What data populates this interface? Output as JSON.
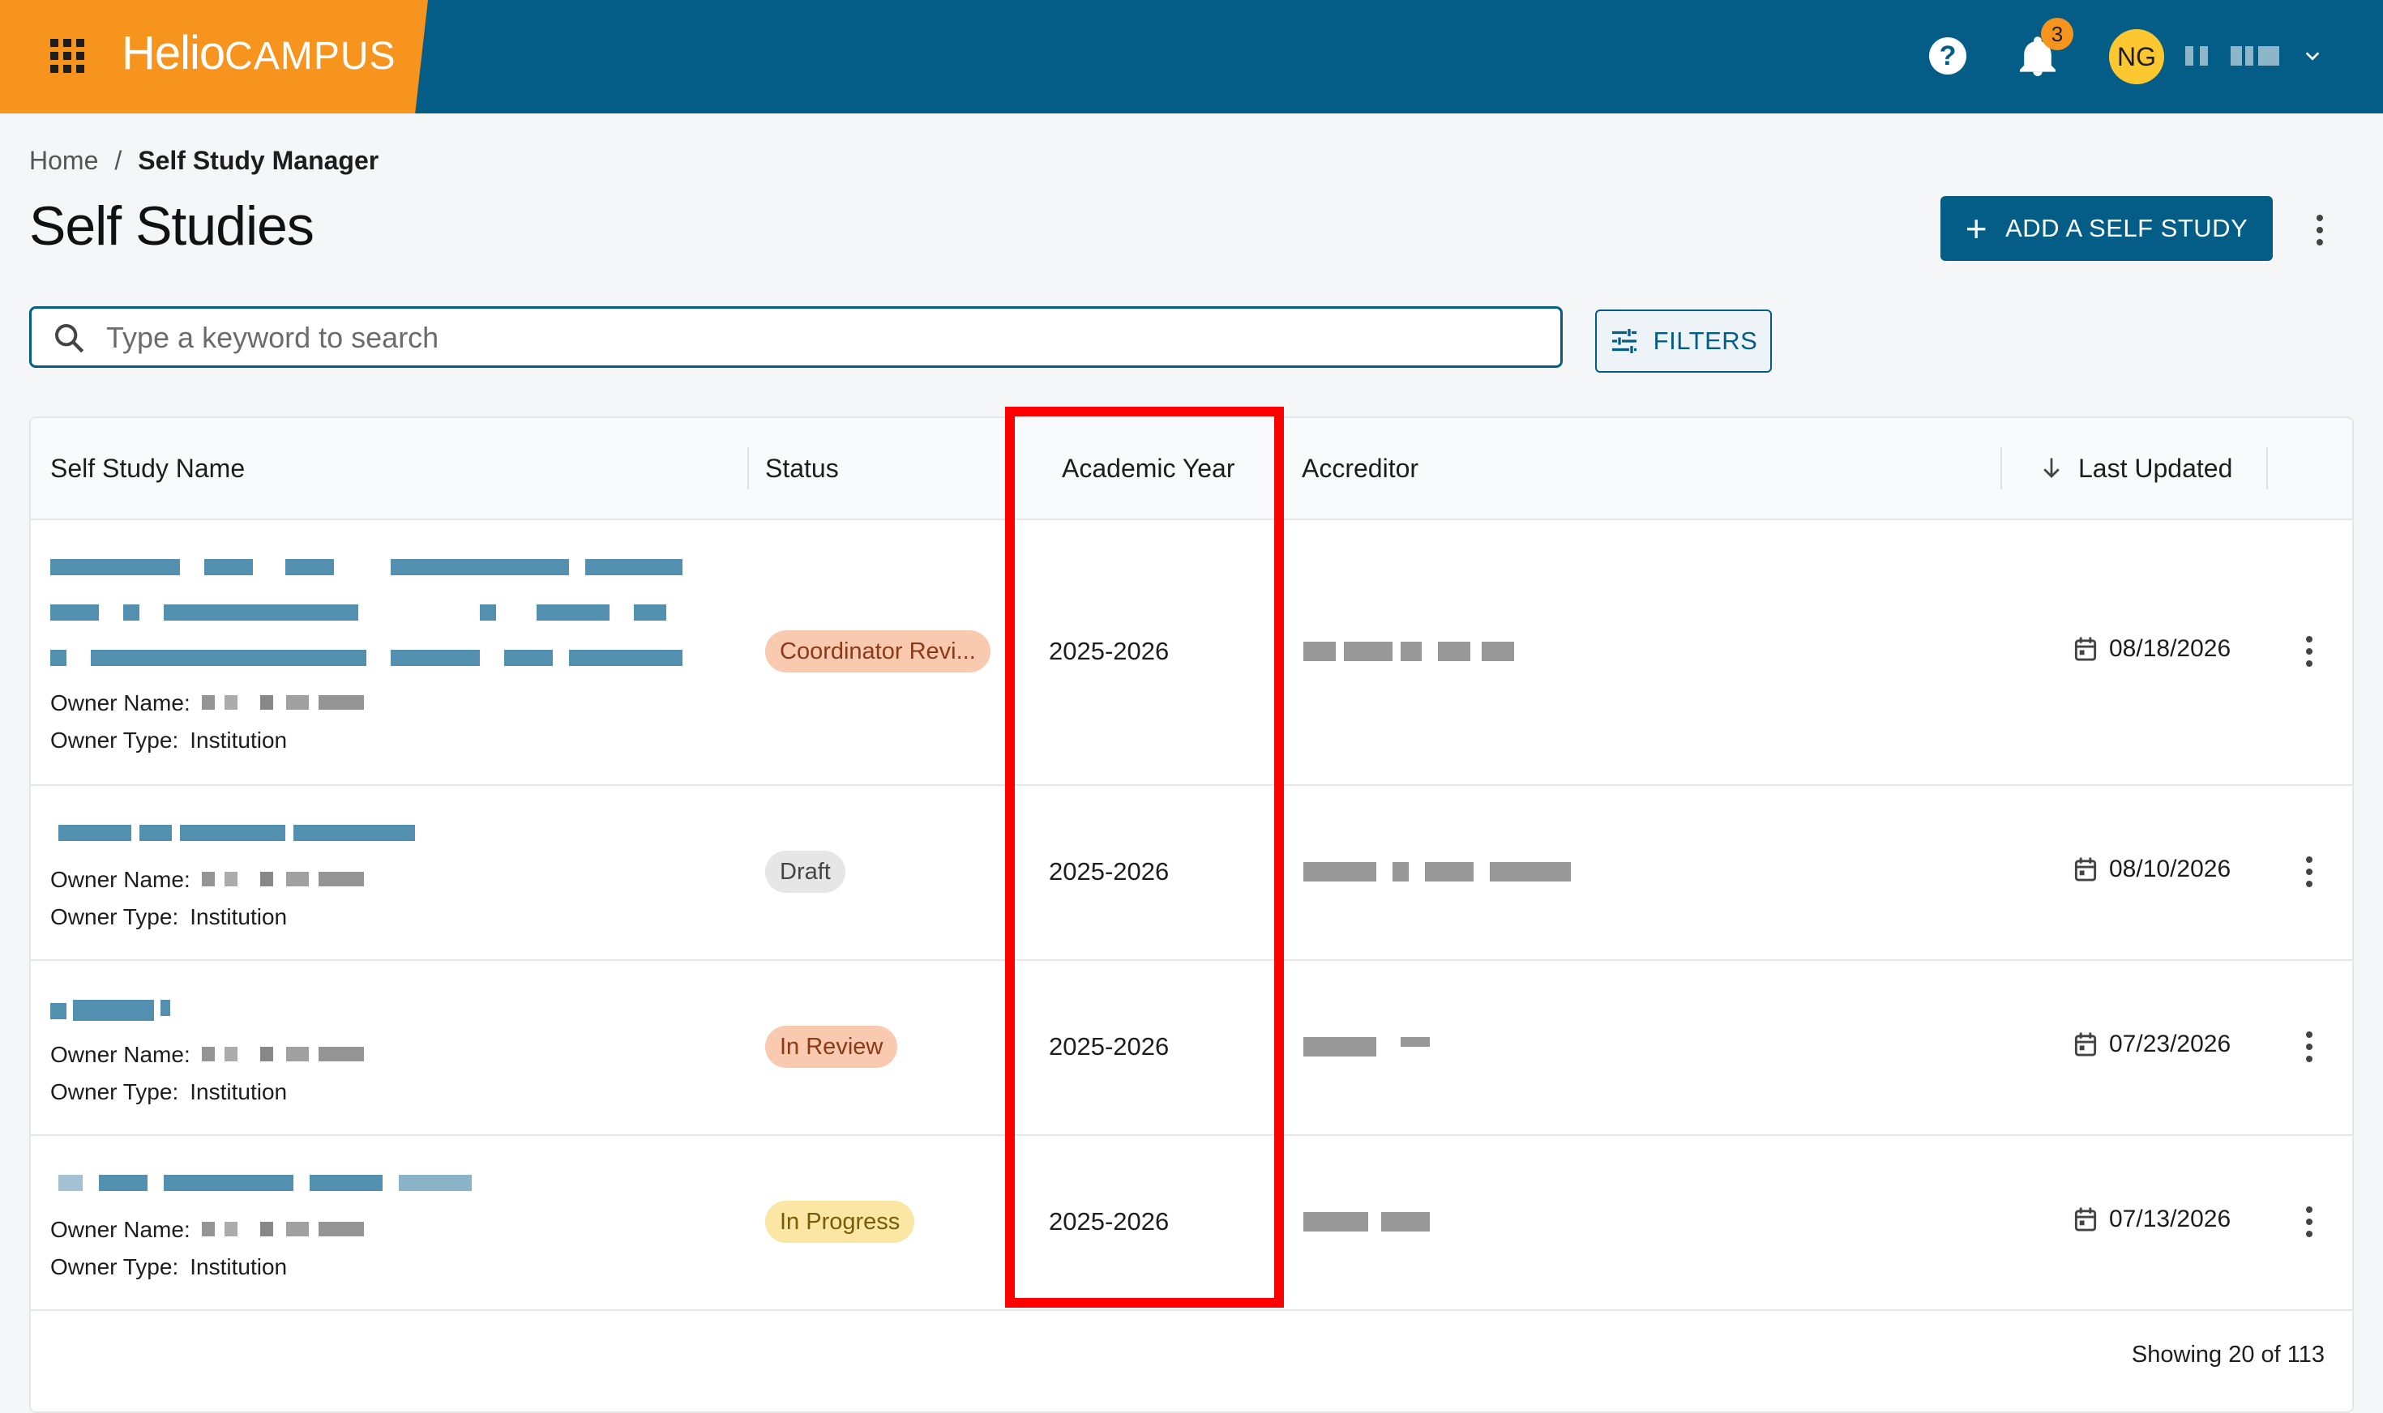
{
  "app": {
    "brand_main": "Helio",
    "brand_sub": "CAMPUS"
  },
  "header": {
    "notification_count": "3",
    "user_initials": "NG"
  },
  "breadcrumb": {
    "home": "Home",
    "separator": "/",
    "current": "Self Study Manager"
  },
  "page": {
    "title": "Self Studies",
    "add_button": "ADD A SELF STUDY"
  },
  "search": {
    "placeholder": "Type a keyword to search",
    "value": ""
  },
  "filters": {
    "label": "FILTERS"
  },
  "table": {
    "columns": {
      "name": "Self Study Name",
      "status": "Status",
      "year": "Academic Year",
      "accreditor": "Accreditor",
      "updated": "Last Updated"
    },
    "owner_name_label": "Owner Name:",
    "owner_type_label": "Owner Type:",
    "rows": [
      {
        "status": "Coordinator Revi...",
        "year": "2025-2026",
        "updated": "08/18/2026",
        "owner_type": "Institution"
      },
      {
        "status": "Draft",
        "year": "2025-2026",
        "updated": "08/10/2026",
        "owner_type": "Institution"
      },
      {
        "status": "In Review",
        "year": "2025-2026",
        "updated": "07/23/2026",
        "owner_type": "Institution"
      },
      {
        "status": "In Progress",
        "year": "2025-2026",
        "updated": "07/13/2026",
        "owner_type": "Institution"
      }
    ],
    "footer": "Showing 20 of 113"
  },
  "colors": {
    "header_bg": "#045d86",
    "brand_bg": "#f7941d",
    "primary": "#045d86",
    "highlight": "#ff0000"
  },
  "icons": {
    "apps": "apps-grid-icon",
    "help": "help-icon",
    "bell": "bell-icon",
    "chevron": "chevron-down-icon",
    "search": "search-icon",
    "filter": "filter-sliders-icon",
    "sort": "arrow-down-icon",
    "calendar": "calendar-icon",
    "more": "more-vertical-icon"
  }
}
